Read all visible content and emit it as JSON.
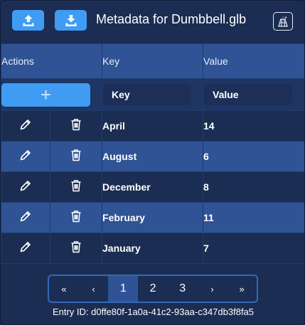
{
  "header": {
    "title": "Metadata for Dumbbell.glb"
  },
  "table": {
    "columns": [
      "Actions",
      "Key",
      "Value"
    ],
    "key_placeholder": "Key",
    "value_placeholder": "Value",
    "rows": [
      {
        "key": "April",
        "value": "14"
      },
      {
        "key": "August",
        "value": "6"
      },
      {
        "key": "December",
        "value": "8"
      },
      {
        "key": "February",
        "value": "11"
      },
      {
        "key": "January",
        "value": "7"
      }
    ]
  },
  "pagination": {
    "first": "«",
    "prev": "‹",
    "pages": [
      "1",
      "2",
      "3"
    ],
    "current_page": "1",
    "next": "›",
    "last": "»"
  },
  "footer": {
    "entry_id": "Entry ID: d0ffe80f-1a0a-41c2-93aa-c347db3f8fa5"
  },
  "colors": {
    "background": "#1b2d52",
    "header_row": "#2f5394",
    "accent_button": "#3f9cf2",
    "pager_border": "#3567b8"
  }
}
